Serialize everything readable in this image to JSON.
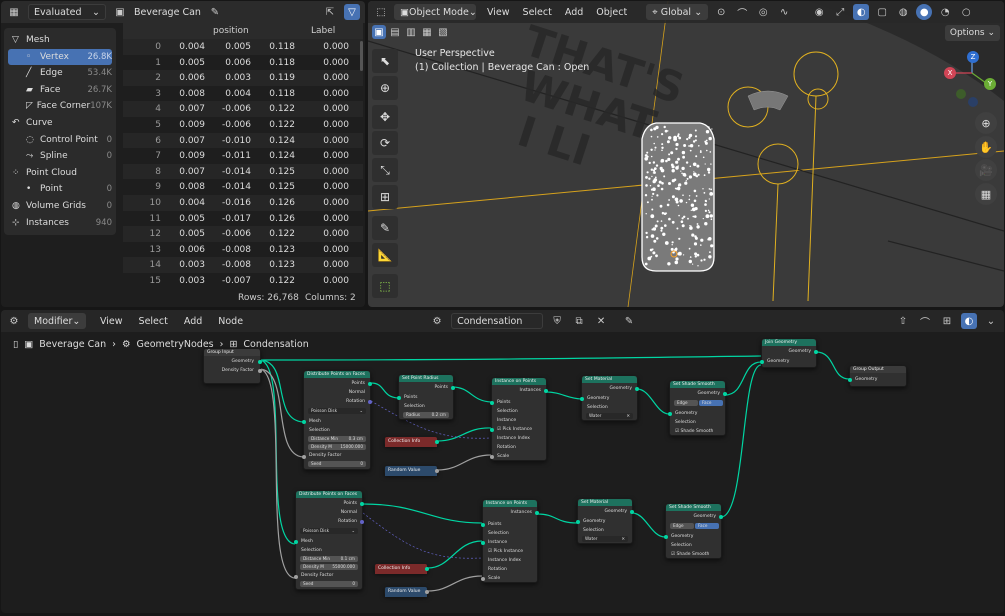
{
  "spreadsheet": {
    "mode": "Evaluated",
    "object": "Beverage Can",
    "col_position": "position",
    "col_label": "Label",
    "tree": [
      {
        "label": "Mesh",
        "count": "",
        "level": 0
      },
      {
        "label": "Vertex",
        "count": "26.8K",
        "level": 1,
        "selected": true
      },
      {
        "label": "Edge",
        "count": "53.4K",
        "level": 1
      },
      {
        "label": "Face",
        "count": "26.7K",
        "level": 1
      },
      {
        "label": "Face Corner",
        "count": "107K",
        "level": 1
      },
      {
        "label": "Curve",
        "count": "",
        "level": 0
      },
      {
        "label": "Control Point",
        "count": "0",
        "level": 1
      },
      {
        "label": "Spline",
        "count": "0",
        "level": 1
      },
      {
        "label": "Point Cloud",
        "count": "",
        "level": 0
      },
      {
        "label": "Point",
        "count": "0",
        "level": 1
      },
      {
        "label": "Volume Grids",
        "count": "0",
        "level": 0
      },
      {
        "label": "Instances",
        "count": "940",
        "level": 0
      }
    ],
    "rows": [
      [
        "0",
        "0.004",
        "0.005",
        "0.118",
        "0.000"
      ],
      [
        "1",
        "0.005",
        "0.006",
        "0.118",
        "0.000"
      ],
      [
        "2",
        "0.006",
        "0.003",
        "0.119",
        "0.000"
      ],
      [
        "3",
        "0.008",
        "0.004",
        "0.118",
        "0.000"
      ],
      [
        "4",
        "0.007",
        "-0.006",
        "0.122",
        "0.000"
      ],
      [
        "5",
        "0.009",
        "-0.006",
        "0.122",
        "0.000"
      ],
      [
        "6",
        "0.007",
        "-0.010",
        "0.124",
        "0.000"
      ],
      [
        "7",
        "0.009",
        "-0.011",
        "0.124",
        "0.000"
      ],
      [
        "8",
        "0.007",
        "-0.014",
        "0.125",
        "0.000"
      ],
      [
        "9",
        "0.008",
        "-0.014",
        "0.125",
        "0.000"
      ],
      [
        "10",
        "0.004",
        "-0.016",
        "0.126",
        "0.000"
      ],
      [
        "11",
        "0.005",
        "-0.017",
        "0.126",
        "0.000"
      ],
      [
        "12",
        "0.005",
        "-0.006",
        "0.122",
        "0.000"
      ],
      [
        "13",
        "0.006",
        "-0.008",
        "0.123",
        "0.000"
      ],
      [
        "14",
        "0.003",
        "-0.008",
        "0.123",
        "0.000"
      ],
      [
        "15",
        "0.003",
        "-0.007",
        "0.122",
        "0.000"
      ]
    ],
    "footer_rows": "Rows: 26,768",
    "footer_cols": "Columns: 2"
  },
  "viewport": {
    "mode": "Object Mode",
    "menus": [
      "View",
      "Select",
      "Add",
      "Object"
    ],
    "transform": "Global",
    "options": "Options",
    "perspective": "User Perspective",
    "collection": "(1) Collection | Beverage Can : Open",
    "bg_text": [
      "THAT'S",
      "WHAT",
      "I LI"
    ],
    "axis_x": "X",
    "axis_y": "Y",
    "axis_z": "Z"
  },
  "node_editor": {
    "editor": "Modifier",
    "menus": [
      "View",
      "Select",
      "Add",
      "Node"
    ],
    "tree_name": "Condensation",
    "breadcrumb": [
      "Beverage Can",
      "GeometryNodes",
      "Condensation"
    ],
    "nodes": {
      "group_input": "Group Input",
      "gi_geometry": "Geometry",
      "gi_density": "Density Factor",
      "dist1": "Distribute Points on Faces",
      "dist_points": "Points",
      "dist_normal": "Normal",
      "dist_rotation": "Rotation",
      "poisson": "Poisson Disk",
      "mesh": "Mesh",
      "selection": "Selection",
      "dist_min1": "Distance Min",
      "dist_min1_val": "0.3 cm",
      "density_max1": "Density M",
      "density_max1_val": "15000.000",
      "density_factor": "Density Factor",
      "seed": "Seed",
      "seed_val": "0",
      "seed2_val": "0",
      "set_radius": "Set Point Radius",
      "points": "Points",
      "radius": "Radius",
      "radius_val": "0.2 cm",
      "inst1": "Instance on Points",
      "instances": "Instances",
      "instance": "Instance",
      "pick_instance": "Pick Instance",
      "instance_index": "Instance Index",
      "rotation": "Rotation",
      "scale": "Scale",
      "coll1": "Collection Info",
      "rand1": "Random Value",
      "mat1": "Set Material",
      "geometry": "Geometry",
      "water": "Water",
      "shade1": "Set Shade Smooth",
      "edge": "Edge",
      "face": "Face",
      "shade_smooth": "Shade Smooth",
      "join": "Join Geometry",
      "group_output": "Group Output",
      "dist2": "Distribute Points on Faces",
      "dist_min2_val": "0.1 cm",
      "density_max2_val": "55000.000",
      "inst2": "Instance on Points",
      "coll2": "Collection Info",
      "rand2": "Random Value",
      "mat2": "Set Material",
      "shade2": "Set Shade Smooth"
    }
  },
  "colors": {
    "accent": "#4772b3",
    "geometry": "#00d6a3",
    "float": "#a1a1a1",
    "vector": "#6363c7"
  }
}
